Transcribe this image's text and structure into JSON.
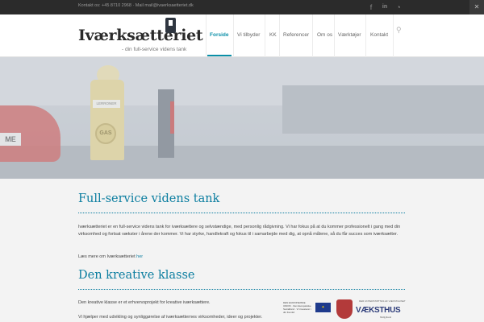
{
  "topbar": {
    "contact": "Kontakt os: +45 8710 2968 · Mail mail@ivaerksaetteriet.dk",
    "social": [
      {
        "icon": "facebook-icon",
        "glyph": "f"
      },
      {
        "icon": "linkedin-icon",
        "glyph": "in"
      },
      {
        "icon": "rss-icon",
        "glyph": "◔"
      }
    ],
    "corner_glyph": "✕"
  },
  "header": {
    "logo": "Iværksætteriet",
    "tagline": "- din full-service videns tank",
    "nav": [
      {
        "label": "Forside",
        "active": true
      },
      {
        "label": "Vi tilbyder",
        "active": false
      },
      {
        "label": "KK",
        "active": false
      },
      {
        "label": "Referencer",
        "active": false
      },
      {
        "label": "Om os",
        "active": false
      },
      {
        "label": "Værktøjer",
        "active": false
      },
      {
        "label": "Kontakt",
        "active": false
      }
    ],
    "accent": "#0a8fa8"
  },
  "hero": {
    "car_sign": "ME",
    "pump_label": "LERRONER",
    "gas_sign": "GAS"
  },
  "section1": {
    "heading": "Full-service videns tank",
    "body": "Iværksætteriet er en full-service videns tank for iværksættere og selvstændige, med personlig rådgivning. Vi har fokus på at du kommer professionelt i gang med din virksomhed og fortsat vækster i årene der kommer. Vi har styrke, handlekraft og fokus til i samarbejde med dig, at opnå målene, så du får succes som iværksætter.",
    "more_text": "Læs mere om Iværksætteriet",
    "more_link": "her"
  },
  "section2": {
    "heading": "Den kreative klasse",
    "body1": "Den kreative klasse er et erhvervsprojekt for kreative iværksættere.",
    "body2": "Vi hjælper med udvikling og synliggørelse af iværksætternes virksomheder, ideer og projekter."
  },
  "logos": {
    "eu_text": "DEN EUROPÆISKE UNION · Den Europæiske Socialfond · Vi investerer i din fremtid",
    "vaekst_small": "DER UNTERSTØTTES AF VÆKSTHUSET",
    "vaekst": "VÆKSTHUS",
    "vaekst_sub": "Midtjylland"
  }
}
